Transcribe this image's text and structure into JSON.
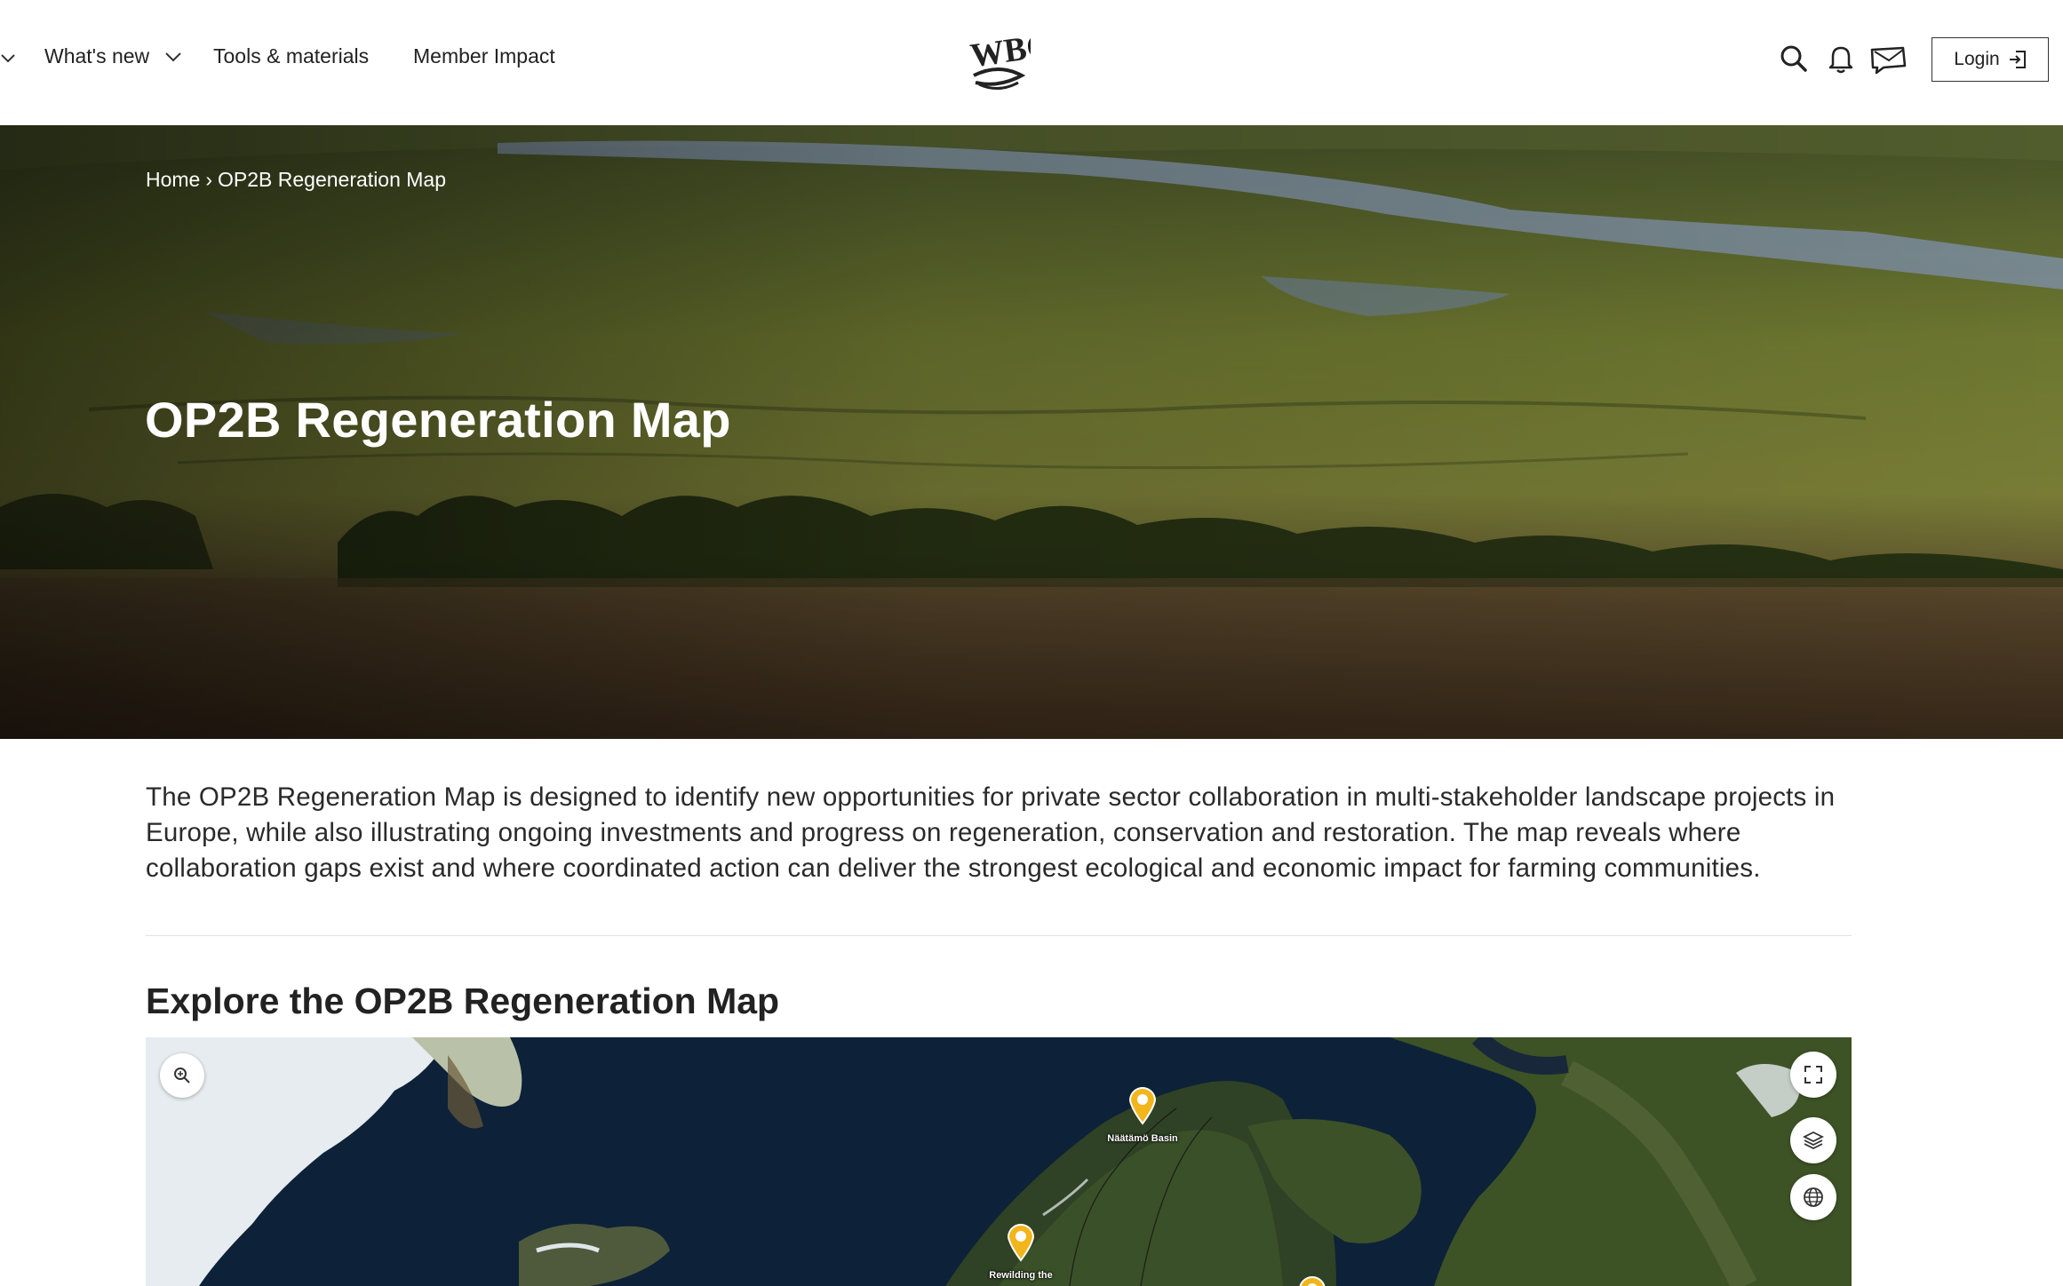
{
  "header": {
    "nav": [
      {
        "label": "What's new"
      },
      {
        "label": "Tools & materials"
      },
      {
        "label": "Member Impact"
      }
    ],
    "logo_text": "WBC",
    "icons": [
      "search-icon",
      "bell-icon",
      "chat-icon"
    ],
    "login_label": "Login"
  },
  "breadcrumb": {
    "home": "Home",
    "separator": "›",
    "current": "OP2B Regeneration Map"
  },
  "hero": {
    "title": "OP2B Regeneration Map"
  },
  "intro": {
    "text": "The OP2B Regeneration Map is designed to identify new opportunities for private sector collaboration in multi-stakeholder landscape projects in Europe, while also illustrating ongoing investments and progress on regeneration, conservation and restoration. The map reveals where collaboration gaps exist and where coordinated action can deliver the strongest ecological and economic impact for farming communities."
  },
  "section": {
    "title": "Explore the OP2B Regeneration Map"
  },
  "map": {
    "pins": [
      {
        "label": "Näätämö Basin"
      },
      {
        "label": "Rewilding the"
      },
      {
        "label": ""
      }
    ],
    "controls": [
      "zoom-search-icon",
      "fullscreen-icon",
      "layers-icon",
      "globe-icon"
    ],
    "pin_color": "#f2b51b"
  }
}
